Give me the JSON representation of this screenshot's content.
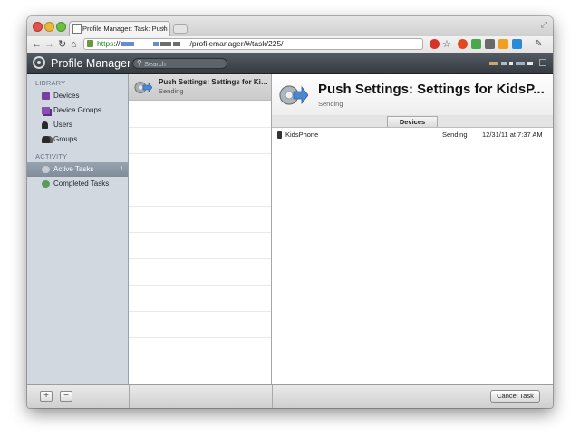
{
  "browser": {
    "tab_title": "Profile Manager: Task: Push",
    "tab_close": "×",
    "new_tab": "+",
    "url_scheme": "https",
    "url_sep": "://",
    "url_path": "/profilemanager/#/task/225/"
  },
  "app": {
    "title": "Profile Manager",
    "search_placeholder": "Search"
  },
  "sidebar": {
    "library_heading": "LIBRARY",
    "activity_heading": "ACTIVITY",
    "items": [
      {
        "label": "Devices"
      },
      {
        "label": "Device Groups"
      },
      {
        "label": "Users"
      },
      {
        "label": "Groups"
      },
      {
        "label": "Active Tasks",
        "count": "1"
      },
      {
        "label": "Completed Tasks"
      }
    ]
  },
  "task_list": [
    {
      "title": "Push Settings: Settings for Kids...",
      "status": "Sending"
    }
  ],
  "detail": {
    "title": "Push Settings: Settings for KidsP...",
    "status": "Sending",
    "tab_devices": "Devices",
    "devices": [
      {
        "name": "KidsPhone",
        "status": "Sending",
        "date": "12/31/11 at 7:37 AM"
      }
    ]
  },
  "bottom": {
    "add_label": "+",
    "remove_label": "−",
    "cancel_label": "Cancel Task"
  },
  "colors": {
    "sidebar_bg": "#d1d8e0",
    "appbar_bg": "#3f454c",
    "active_item": "#8b96a3"
  }
}
